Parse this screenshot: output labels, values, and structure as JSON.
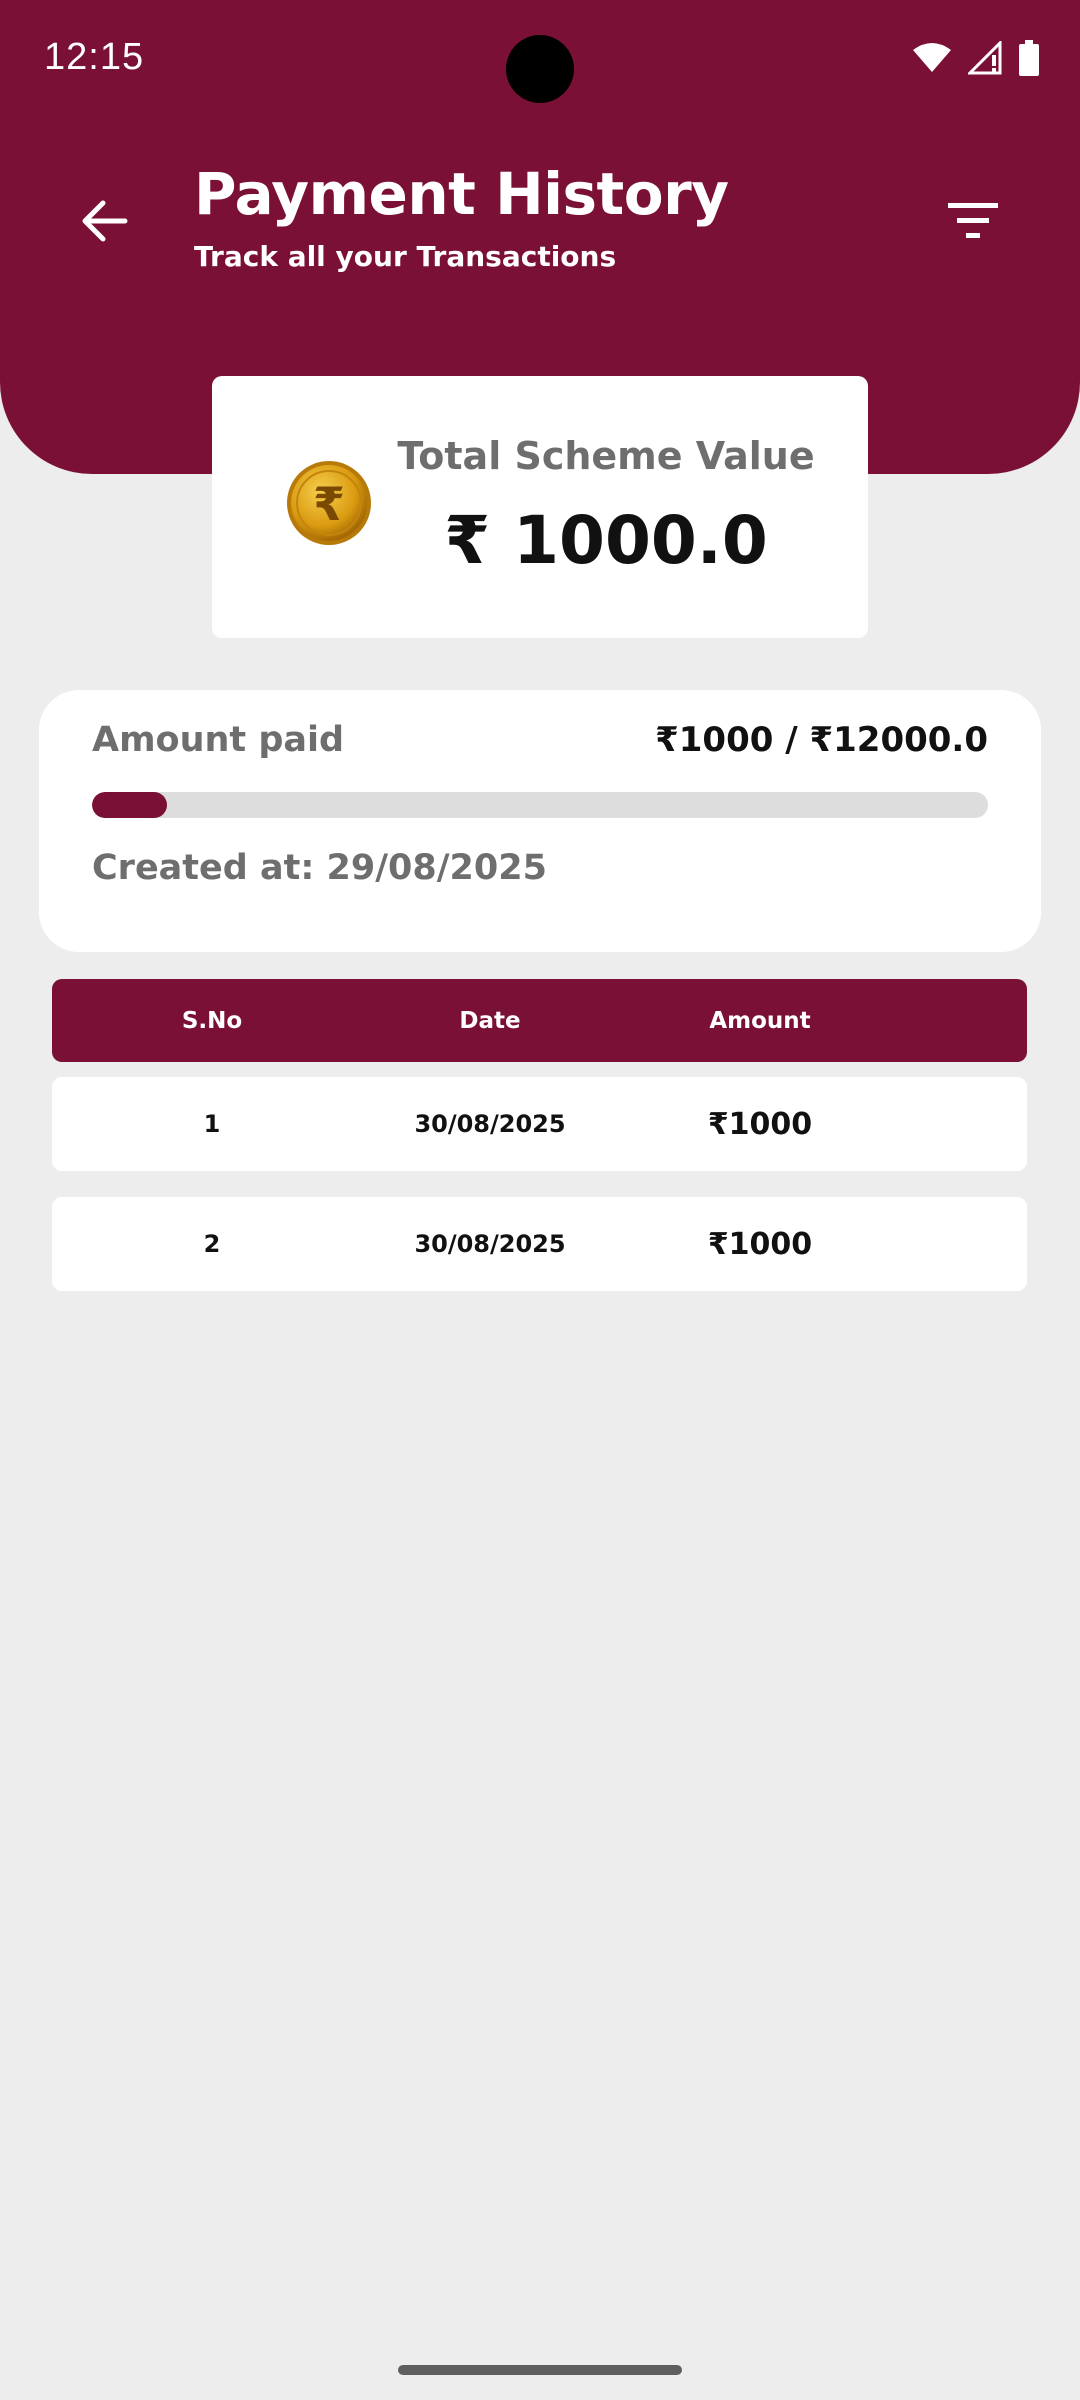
{
  "status_bar": {
    "time": "12:15",
    "icons": [
      "wifi-icon",
      "signal-icon",
      "battery-icon"
    ]
  },
  "header": {
    "title": "Payment History",
    "subtitle": "Track all your Transactions",
    "back_icon": "arrow-left-icon",
    "filter_icon": "filter-icon",
    "color": "#7b1036"
  },
  "scheme_card": {
    "coin_icon": "rupee-coin-icon",
    "label": "Total Scheme Value",
    "value": "₹ 1000.0"
  },
  "progress": {
    "label": "Amount paid",
    "value": "₹1000 / ₹12000.0",
    "paid": 1000,
    "total": 12000,
    "created": "Created at: 29/08/2025"
  },
  "table": {
    "headers": [
      "S.No",
      "Date",
      "Amount"
    ],
    "rows": [
      {
        "sno": "1",
        "date": "30/08/2025",
        "amount": "₹1000"
      },
      {
        "sno": "2",
        "date": "30/08/2025",
        "amount": "₹1000"
      }
    ]
  }
}
